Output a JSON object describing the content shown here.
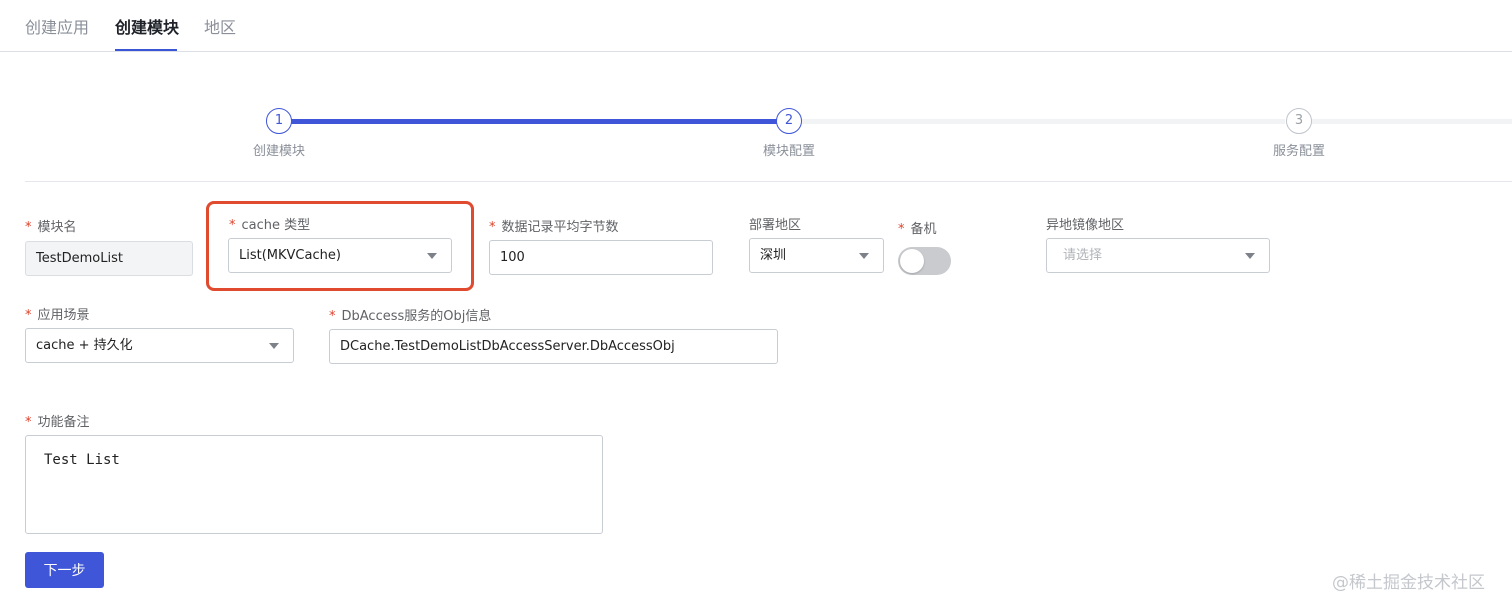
{
  "tabs": [
    {
      "label": "创建应用",
      "active": false
    },
    {
      "label": "创建模块",
      "active": true
    },
    {
      "label": "地区",
      "active": false
    }
  ],
  "steps": [
    {
      "number": "1",
      "label": "创建模块",
      "status": "done"
    },
    {
      "number": "2",
      "label": "模块配置",
      "status": "current"
    },
    {
      "number": "3",
      "label": "服务配置",
      "status": "todo"
    }
  ],
  "form": {
    "required_mark": "*",
    "module_name": {
      "label": "模块名",
      "value": "TestDemoList"
    },
    "cache_type": {
      "label": "cache 类型",
      "value": "List(MKVCache)"
    },
    "avg_bytes": {
      "label": "数据记录平均字节数",
      "value": "100"
    },
    "deploy_region": {
      "label": "部署地区",
      "value": "深圳"
    },
    "backup": {
      "label": "备机",
      "enabled": false
    },
    "mirror_region": {
      "label": "异地镜像地区",
      "placeholder": "请选择"
    },
    "scenario": {
      "label": "应用场景",
      "value": "cache + 持久化"
    },
    "dbaccess_obj": {
      "label": "DbAccess服务的Obj信息",
      "value": "DCache.TestDemoListDbAccessServer.DbAccessObj"
    },
    "remark": {
      "label": "功能备注",
      "value": "Test List"
    }
  },
  "buttons": {
    "next": "下一步"
  },
  "watermark": "@稀土掘金技术社区",
  "colors": {
    "accent": "#3f56d9",
    "highlight": "#e04a2f",
    "required": "#e0412b"
  }
}
